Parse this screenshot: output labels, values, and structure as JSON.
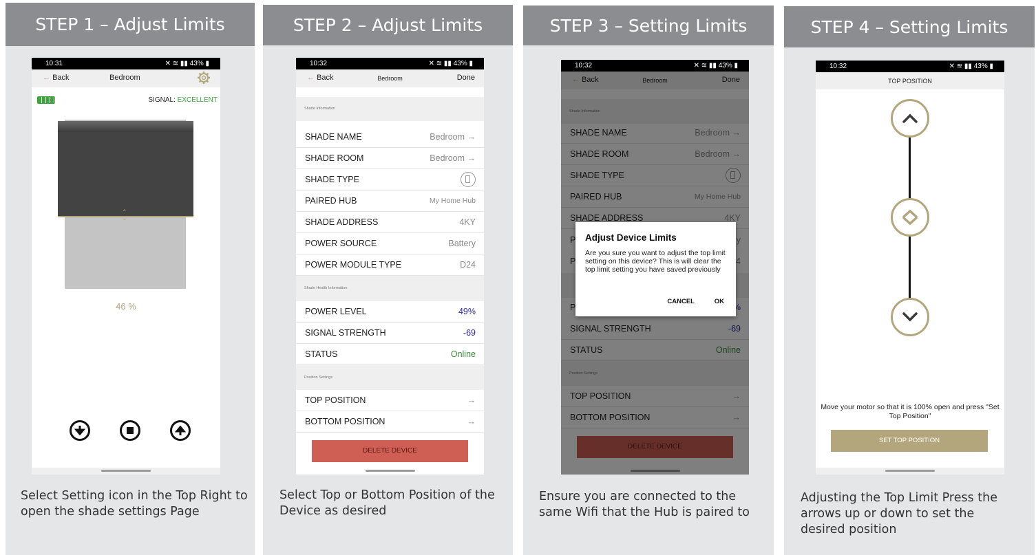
{
  "steps": [
    {
      "title": "STEP 1 – Adjust Limits",
      "caption": "Select Setting icon in the Top Right to open the shade settings Page"
    },
    {
      "title": "STEP 2 – Adjust Limits",
      "caption": "Select Top or Bottom Position of the Device as desired"
    },
    {
      "title": "STEP 3 – Setting Limits",
      "caption": "Ensure you are connected to the same Wifi that the Hub is paired to"
    },
    {
      "title": "STEP 4 – Setting Limits",
      "caption": "Adjusting the Top Limit Press the arrows up or down to set the desired position"
    }
  ],
  "phone1": {
    "time": "10:31",
    "battery_pct": "43%",
    "back": "Back",
    "title": "Bedroom",
    "signal_label": "SIGNAL:",
    "signal_value": "EXCELLENT",
    "position_text": "46 %",
    "position_pct": 46
  },
  "phone2": {
    "time": "10:32",
    "battery_pct": "43%",
    "back": "Back",
    "title": "Bedroom",
    "done": "Done",
    "section_info": "Shade Information",
    "section_health": "Shade Health Information",
    "section_position": "Position Settings",
    "rows_info": [
      {
        "label": "SHADE NAME",
        "value": "Bedroom →"
      },
      {
        "label": "SHADE ROOM",
        "value": "Bedroom →"
      },
      {
        "label": "SHADE TYPE",
        "value": ""
      },
      {
        "label": "PAIRED HUB",
        "value": "My Home Hub"
      },
      {
        "label": "SHADE ADDRESS",
        "value": "4KY"
      },
      {
        "label": "POWER SOURCE",
        "value": "Battery"
      },
      {
        "label": "POWER MODULE TYPE",
        "value": "D24"
      }
    ],
    "rows_health": [
      {
        "label": "POWER LEVEL",
        "value": "49%"
      },
      {
        "label": "SIGNAL STRENGTH",
        "value": "-69"
      },
      {
        "label": "STATUS",
        "value": "Online"
      }
    ],
    "rows_position": [
      {
        "label": "TOP POSITION",
        "value": "→"
      },
      {
        "label": "BOTTOM POSITION",
        "value": "→"
      }
    ],
    "delete": "DELETE DEVICE"
  },
  "phone3": {
    "time": "10:32",
    "battery_pct": "43%",
    "back": "Back",
    "title": "Bedroom",
    "done": "Done",
    "section_info": "Shade Information",
    "section_position": "Position Settings",
    "rows": [
      {
        "label": "SHADE NAME",
        "value": "Bedroom →"
      },
      {
        "label": "SHADE ROOM",
        "value": "Bedroom →"
      },
      {
        "label": "SHADE TYPE",
        "value": ""
      },
      {
        "label": "PAIRED HUB",
        "value": "My Home Hub"
      },
      {
        "label": "SHADE ADDRESS",
        "value": "4KY"
      }
    ],
    "partial_p1": "P",
    "partial_y": "y",
    "partial_p2": "P",
    "partial_4": "4",
    "partial_p3": "P",
    "partial_pct": "%",
    "rows_lower": [
      {
        "label": "SIGNAL STRENGTH",
        "value": "-69"
      },
      {
        "label": "STATUS",
        "value": "Online"
      }
    ],
    "rows_position": [
      {
        "label": "TOP POSITION",
        "value": "→"
      },
      {
        "label": "BOTTOM POSITION",
        "value": "→"
      }
    ],
    "delete": "DELETE DEVICE",
    "dialog": {
      "title": "Adjust Device Limits",
      "body": "Are you sure you want to adjust the top limit setting on this device? This is will clear the top limit setting you have saved previously",
      "cancel": "CANCEL",
      "ok": "OK"
    }
  },
  "phone4": {
    "time": "10:32",
    "battery_pct": "43%",
    "title": "TOP POSITION",
    "instruction": "Move your motor so that it is 100% open and press \"Set Top Position\"",
    "button": "SET TOP POSITION"
  },
  "colors": {
    "header_bg": "#8b8d90",
    "card_bg": "#e5e6e8",
    "accent_gold": "#b4a67c",
    "delete_red": "#cf5f55",
    "signal_green": "#3aa63a",
    "value_blue": "#2a2aa8"
  }
}
